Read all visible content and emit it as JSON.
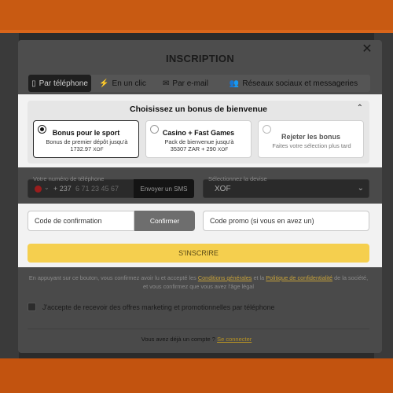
{
  "modal": {
    "title": "INSCRIPTION",
    "close_icon": "close-icon"
  },
  "tabs": [
    {
      "label": "Par téléphone",
      "icon": "phone-icon",
      "active": true
    },
    {
      "label": "En un clic",
      "icon": "bolt-icon",
      "active": false
    },
    {
      "label": "Par e-mail",
      "icon": "mail-icon",
      "active": false
    },
    {
      "label": "Réseaux sociaux et messageries",
      "icon": "users-icon",
      "active": false
    }
  ],
  "bonus": {
    "title": "Choisissez un bonus de bienvenue",
    "options": [
      {
        "title": "Bonus pour le sport",
        "desc_line1": "Bonus de premier dépôt jusqu'à",
        "amount": "1732.97",
        "currency": "XOF",
        "selected": true
      },
      {
        "title": "Casino + Fast Games",
        "desc_line1": "Pack de bienvenue jusqu'à",
        "amount": "35307 ZAR + 290",
        "currency": "XOF",
        "selected": false
      },
      {
        "title": "Rejeter les bonus",
        "desc_line1": "Faites votre sélection plus tard",
        "amount": "",
        "currency": "",
        "selected": false
      }
    ]
  },
  "phone": {
    "label": "Votre numéro de téléphone",
    "dial_code": "+ 237",
    "placeholder": "6 71 23 45 67",
    "sms_button": "Envoyer un SMS"
  },
  "currency": {
    "label": "Sélectionnez la devise",
    "value": "XOF"
  },
  "confirmation": {
    "placeholder": "Code de confirmation",
    "button": "Confirmer"
  },
  "promo": {
    "placeholder": "Code promo (si vous en avez un)"
  },
  "signup": {
    "button": "S'INSCRIRE"
  },
  "legal": {
    "part1": "En appuyant sur ce bouton, vous confirmez avoir lu et accepté les ",
    "link1": "Conditions générales",
    "part2": " et la ",
    "link2": "Politique de confidentialité",
    "part3": " de la société, et vous confirmez que vous avez l'âge légal"
  },
  "marketing": {
    "label": "J'accepte de recevoir des offres marketing et promotionnelles par téléphone"
  },
  "login": {
    "text": "Vous avez déjà un compte ? ",
    "link": "Se connecter"
  },
  "colors": {
    "accent": "#f5cf4e",
    "header_bg": "#c85a12"
  }
}
